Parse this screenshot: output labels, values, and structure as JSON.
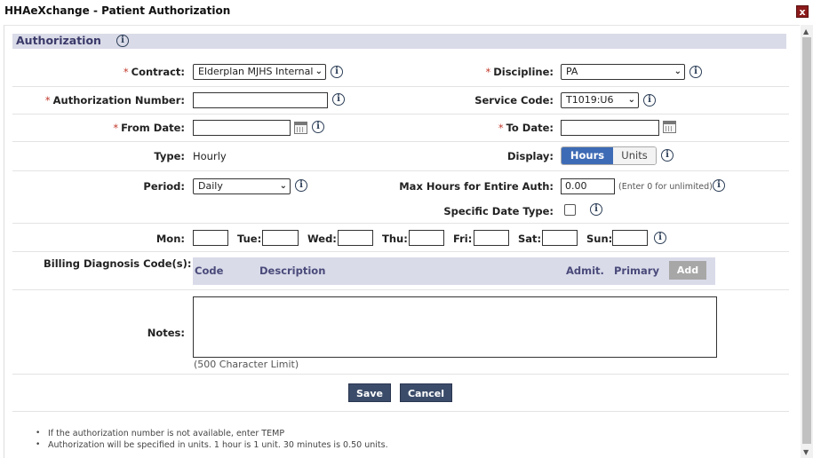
{
  "window": {
    "title": "HHAeXchange - Patient Authorization",
    "close_label": "x"
  },
  "section": {
    "title": "Authorization",
    "info_glyph": "i"
  },
  "required_marker": "*",
  "fields": {
    "contract": {
      "label": "Contract:",
      "value": "Elderplan MJHS Internal"
    },
    "discipline": {
      "label": "Discipline:",
      "value": "PA"
    },
    "auth_number": {
      "label": "Authorization Number:",
      "value": ""
    },
    "service_code": {
      "label": "Service Code:",
      "value": "T1019:U6"
    },
    "from_date": {
      "label": "From Date:",
      "value": ""
    },
    "to_date": {
      "label": "To Date:",
      "value": ""
    },
    "type": {
      "label": "Type:",
      "value": "Hourly"
    },
    "display": {
      "label": "Display:",
      "options": [
        "Hours",
        "Units"
      ],
      "selected": "Hours"
    },
    "period": {
      "label": "Period:",
      "value": "Daily"
    },
    "max_hours": {
      "label": "Max Hours for Entire Auth:",
      "value": "0.00",
      "hint": "(Enter 0 for unlimited)"
    },
    "specific_date_type": {
      "label": "Specific Date Type:",
      "checked": false
    }
  },
  "days": [
    {
      "label": "Mon:",
      "value": ""
    },
    {
      "label": "Tue:",
      "value": ""
    },
    {
      "label": "Wed:",
      "value": ""
    },
    {
      "label": "Thu:",
      "value": ""
    },
    {
      "label": "Fri:",
      "value": ""
    },
    {
      "label": "Sat:",
      "value": ""
    },
    {
      "label": "Sun:",
      "value": ""
    }
  ],
  "billing": {
    "label": "Billing Diagnosis Code(s):",
    "columns": [
      "Code",
      "Description",
      "Admit.",
      "Primary"
    ],
    "add_label": "Add"
  },
  "notes": {
    "label": "Notes:",
    "value": "",
    "limit": "(500 Character Limit)"
  },
  "actions": {
    "save": "Save",
    "cancel": "Cancel"
  },
  "footnotes": [
    "If the authorization number is not available, enter TEMP",
    "Authorization will be specified in units. 1 hour is 1 unit. 30 minutes is 0.50 units."
  ],
  "colors": {
    "accent": "#3e6bb5",
    "button": "#3b4c6a",
    "header_bg": "#dadbe8",
    "required": "#c0392b"
  }
}
